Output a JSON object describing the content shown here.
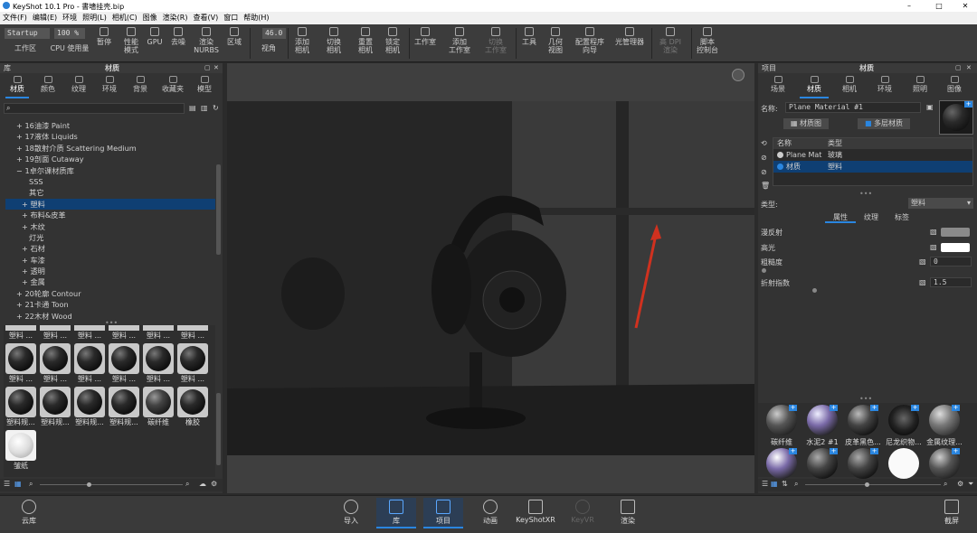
{
  "window": {
    "title": "KeyShot 10.1 Pro - 書墻挂壳.bip",
    "min": "–",
    "max": "□",
    "close": "✕"
  },
  "menu": [
    "文件(F)",
    "编辑(E)",
    "环境",
    "照明(L)",
    "相机(C)",
    "图像",
    "渲染(R)",
    "查看(V)",
    "窗口",
    "帮助(H)"
  ],
  "toolbar": {
    "startup": "Startup",
    "percent": "100 %",
    "fov": "46.0",
    "items": [
      {
        "label": "工作区"
      },
      {
        "label": "CPU 使用量"
      },
      {
        "label": "暂停"
      },
      {
        "label": "性能\n模式"
      },
      {
        "label": "GPU"
      },
      {
        "label": "去噪"
      },
      {
        "label": "渲染\nNURBS"
      },
      {
        "label": "区域"
      },
      {
        "label": "视角"
      },
      {
        "label": "添加\n相机"
      },
      {
        "label": "切换\n相机"
      },
      {
        "label": "重置\n相机"
      },
      {
        "label": "锁定\n相机"
      },
      {
        "label": "工作室"
      },
      {
        "label": "添加\n工作室"
      },
      {
        "label": "切换\n工作室"
      },
      {
        "label": "工具"
      },
      {
        "label": "几何\n视图"
      },
      {
        "label": "配置程序\n向导"
      },
      {
        "label": "光管理器"
      },
      {
        "label": "高 DPI\n渲染"
      },
      {
        "label": "脚本\n控制台"
      }
    ]
  },
  "library": {
    "header_left": "库",
    "header_title": "材质",
    "tabs": [
      "材质",
      "颜色",
      "纹理",
      "环境",
      "背景",
      "收藏夹",
      "模型"
    ],
    "tree": [
      "16油漆 Paint",
      "17液体 Liquids",
      "18散射介质 Scattering Medium",
      "19剖面 Cutaway",
      "1卓尔课材质库",
      "SSS",
      "其它",
      "塑料",
      "布料&皮革",
      "木纹",
      "灯光",
      "石材",
      "车漆",
      "透明",
      "金属",
      "20轮廓 Contour",
      "21卡通 Toon",
      "22木材 Wood"
    ],
    "thumbs": [
      "塑料 ...",
      "塑料 ...",
      "塑料 ...",
      "塑料 ...",
      "塑料 ...",
      "塑料 ...",
      "塑料规...",
      "塑料规...",
      "塑料规...",
      "塑料规...",
      "碳纤维",
      "橡胶",
      "皱纸"
    ]
  },
  "project": {
    "header_left": "项目",
    "header_title": "材质",
    "tabs": [
      "场景",
      "材质",
      "相机",
      "环境",
      "照明",
      "图像"
    ],
    "name_label": "名称:",
    "name_value": "Plane Material #1",
    "btn_graph": "材质图",
    "btn_multi": "多层材质",
    "col_name": "名称",
    "col_type": "类型",
    "rows": [
      {
        "name": "Plane Mat",
        "type": "玻璃"
      },
      {
        "name": "材质",
        "type": "塑料"
      }
    ],
    "type_label": "类型:",
    "type_value": "塑料",
    "subtabs": [
      "属性",
      "纹理",
      "标签"
    ],
    "props": [
      {
        "label": "漫反射"
      },
      {
        "label": "高光"
      },
      {
        "label": "粗糙度",
        "value": "0"
      },
      {
        "label": "折射指数",
        "value": "1.5"
      }
    ],
    "swatch_diffuse": "#8a8a8a",
    "swatch_spec": "#ffffff",
    "mats": [
      "碳纤维",
      "水泥2 #1",
      "皮革黑色...",
      "尼龙织物...",
      "金属纹理..."
    ]
  },
  "bottom": {
    "cloud": "云库",
    "items": [
      "导入",
      "库",
      "项目",
      "动画",
      "KeyShotXR",
      "KeyVR",
      "渲染"
    ],
    "screenshot": "截屏"
  },
  "colors": {
    "accent": "#2a86e0",
    "selection": "#0f3f73"
  }
}
